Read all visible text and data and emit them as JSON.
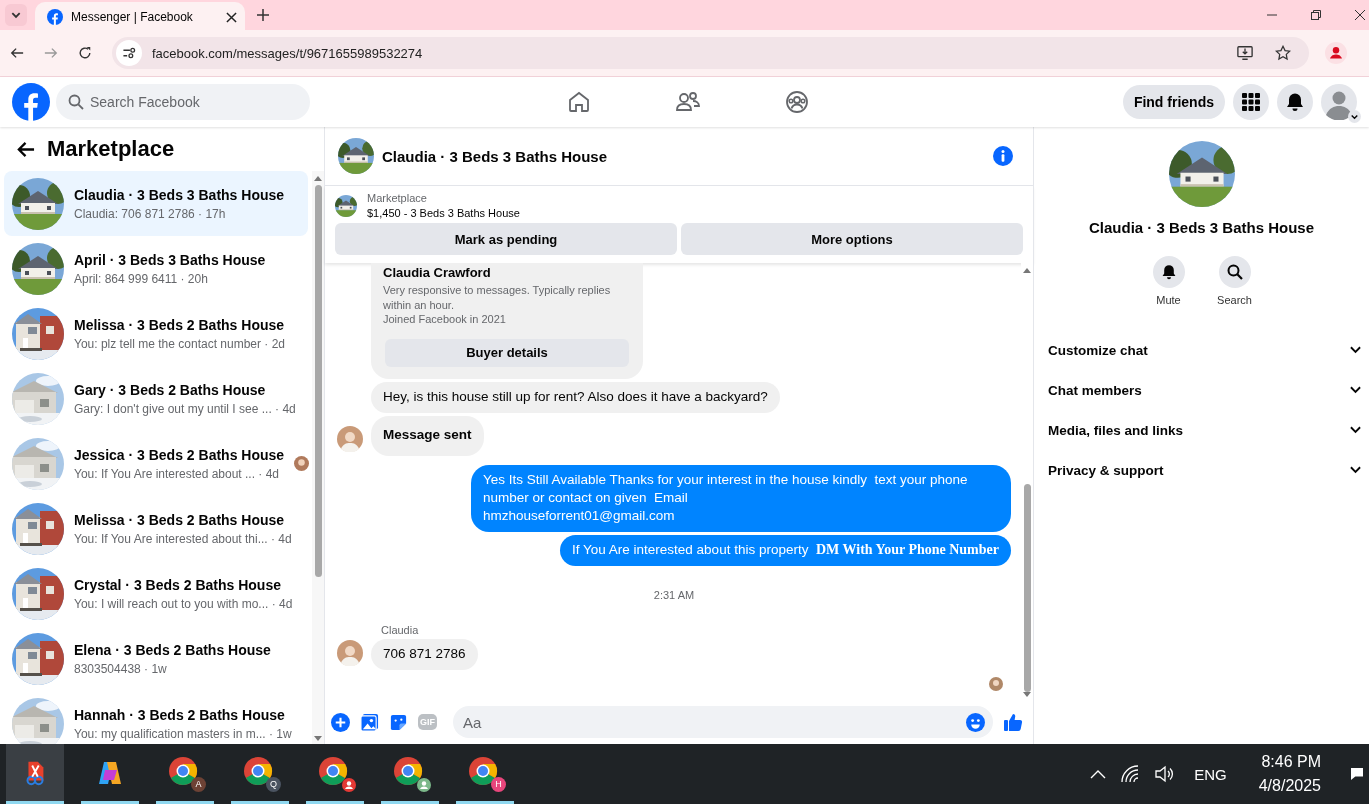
{
  "browser": {
    "tab_title": "Messenger | Facebook",
    "url": "facebook.com/messages/t/9671655989532274"
  },
  "header": {
    "search_placeholder": "Search Facebook",
    "find_friends": "Find friends"
  },
  "sidebar": {
    "title": "Marketplace",
    "conversations": [
      {
        "name": "Claudia · 3 Beds 3 Baths House",
        "preview": "Claudia: 706 871 2786 · 17h",
        "selected": true,
        "seen": false
      },
      {
        "name": "April · 3 Beds 3 Baths House",
        "preview": "April: 864 999 6411 · 20h",
        "selected": false,
        "seen": false
      },
      {
        "name": "Melissa · 3 Beds 2 Baths House",
        "preview": "You: plz tell me the contact number · 2d",
        "selected": false,
        "seen": false
      },
      {
        "name": "Gary · 3 Beds 2 Baths House",
        "preview": "Gary: I don't give out my until I see ... · 4d",
        "selected": false,
        "seen": false
      },
      {
        "name": "Jessica · 3 Beds 2 Baths House",
        "preview": "You: If You Are interested about ... · 4d",
        "selected": false,
        "seen": true
      },
      {
        "name": "Melissa · 3 Beds 2 Baths House",
        "preview": "You: If You Are interested about thi... · 4d",
        "selected": false,
        "seen": false
      },
      {
        "name": "Crystal · 3 Beds 2 Baths House",
        "preview": "You: I will reach out to you with mo... · 4d",
        "selected": false,
        "seen": false
      },
      {
        "name": "Elena · 3 Beds 2 Baths House",
        "preview": "8303504438 · 1w",
        "selected": false,
        "seen": false
      },
      {
        "name": "Hannah · 3 Beds 2 Baths House",
        "preview": "You: my qualification masters in m... · 1w",
        "selected": false,
        "seen": false
      }
    ]
  },
  "chat": {
    "title": "Claudia · 3 Beds 3 Baths House",
    "listing": {
      "label": "Marketplace",
      "title": "$1,450 - 3 Beds 3 Baths House",
      "buttons": [
        "Mark as pending",
        "More options"
      ]
    },
    "messages": [
      {
        "kind": "profile",
        "name": "Claudia Crawford",
        "text": "Very responsive to messages. Typically replies within an hour.",
        "joined": "Joined Facebook in 2021",
        "button": "Buyer details"
      },
      {
        "kind": "incoming",
        "text": "Hey, is this house still up for rent? Also does it have a backyard?",
        "bold": false,
        "avatar": false
      },
      {
        "kind": "incoming",
        "text": "Message sent",
        "bold": true,
        "avatar": true
      },
      {
        "kind": "outgoing",
        "text": "Yes Its Still Available Thanks for your interest in the house kindly  text your phone number or contact on given  Email\nhmzhouseforrent01@gmail.com"
      },
      {
        "kind": "outgoing",
        "text": "If You Are interested about this property  **DM With Your Phone Number**"
      },
      {
        "kind": "time",
        "text": "2:31 AM"
      },
      {
        "kind": "sender",
        "text": "Claudia"
      },
      {
        "kind": "incoming",
        "text": "706 871 2786",
        "bold": false,
        "avatar": true
      }
    ],
    "read_receipt": true,
    "composer": {
      "placeholder": "Aa",
      "gif_label": "GIF"
    }
  },
  "details": {
    "title": "Claudia · 3 Beds 3 Baths House",
    "actions": [
      {
        "kind": "bell",
        "label": "Mute"
      },
      {
        "kind": "search",
        "label": "Search"
      }
    ],
    "sections": [
      {
        "label": "Customize chat",
        "expanded": false
      },
      {
        "label": "Chat members",
        "expanded": false
      },
      {
        "label": "Media, files and links",
        "expanded": false
      },
      {
        "label": "Privacy & support",
        "expanded": false
      }
    ]
  },
  "taskbar": {
    "apps": [
      {
        "kind": "snip",
        "selected": true
      },
      {
        "kind": "copilot",
        "selected": false
      },
      {
        "kind": "chrome",
        "badge": "A",
        "color": "#6d4235",
        "selected": false
      },
      {
        "kind": "chrome",
        "badge": "Q",
        "color": "#4a5360",
        "selected": false
      },
      {
        "kind": "chrome-profile",
        "color": "#e53935",
        "selected": false
      },
      {
        "kind": "chrome-profile",
        "color": "#7cb88a",
        "selected": false
      },
      {
        "kind": "chrome",
        "badge": "H",
        "color": "#e8467c",
        "selected": false
      }
    ],
    "language": "ENG",
    "time": "8:46 PM",
    "date": "4/8/2025"
  }
}
